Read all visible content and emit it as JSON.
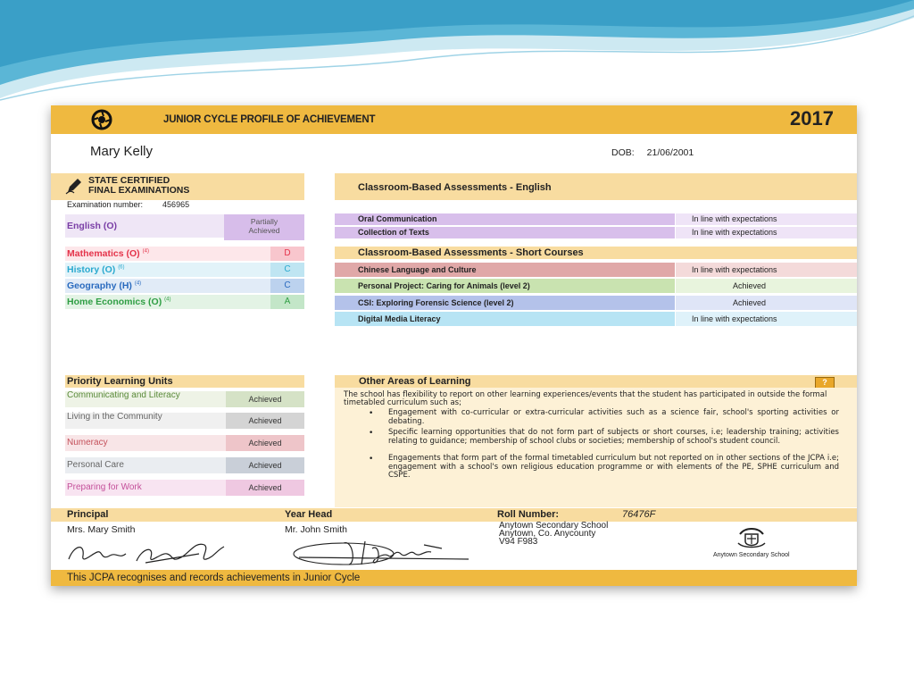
{
  "header": {
    "title": "JUNIOR CYCLE PROFILE OF ACHIEVEMENT",
    "year": "2017"
  },
  "student": {
    "name": "Mary Kelly",
    "dob_label": "DOB:",
    "dob": "21/06/2001"
  },
  "state_exams": {
    "heading_line1": "STATE CERTIFIED",
    "heading_line2": "FINAL EXAMINATIONS",
    "exam_number_label": "Examination number:",
    "exam_number": "456965",
    "subjects": [
      {
        "name": "English (O)",
        "note": "",
        "grade": "Partially Achieved",
        "color": "#7a3fa6"
      },
      {
        "name": "Mathematics (O)",
        "note": "(4)",
        "grade": "D",
        "color": "#e4334a"
      },
      {
        "name": "History (O)",
        "note": "(6)",
        "grade": "C",
        "color": "#2aa9cf"
      },
      {
        "name": "Geography (H)",
        "note": "(4)",
        "grade": "C",
        "color": "#2a6bbf"
      },
      {
        "name": "Home Economics (O)",
        "note": "(4)",
        "grade": "A",
        "color": "#2f9e44"
      }
    ],
    "english_grade_line1": "Partially",
    "english_grade_line2": "Achieved"
  },
  "cba_english": {
    "heading": "Classroom-Based Assessments - English",
    "rows": [
      {
        "name": "Oral Communication",
        "result": "In line with expectations"
      },
      {
        "name": "Collection of Texts",
        "result": "In line with expectations"
      }
    ]
  },
  "cba_short": {
    "heading": "Classroom-Based Assessments - Short Courses",
    "rows": [
      {
        "name": "Chinese Language and Culture",
        "result": "In line with expectations"
      },
      {
        "name": "Personal Project: Caring for Animals (level 2)",
        "result": "Achieved"
      },
      {
        "name": "CSI: Exploring Forensic Science (level 2)",
        "result": "Achieved"
      },
      {
        "name": "Digital Media Literacy",
        "result": "In line with expectations"
      }
    ]
  },
  "plu": {
    "heading": "Priority Learning Units",
    "rows": [
      {
        "name": "Communicating and Literacy",
        "result": "Achieved"
      },
      {
        "name": "Living in the Community",
        "result": "Achieved"
      },
      {
        "name": "Numeracy",
        "result": "Achieved"
      },
      {
        "name": "Personal Care",
        "result": "Achieved"
      },
      {
        "name": "Preparing for Work",
        "result": "Achieved"
      }
    ]
  },
  "other_areas": {
    "heading": "Other Areas of Learning",
    "badge": "?",
    "intro": "The school has flexibility to report on other learning experiences/events that the student has participated in outside the formal timetabled curriculum such as;",
    "bullets": [
      "Engagement with co-curricular or extra-curricular activities such as a science fair, school's sporting activities or debating.",
      "Specific learning opportunities that do not form part of subjects or short courses, i.e; leadership training; activities relating to guidance; membership of school clubs or societies; membership of school's student council.",
      "Engagements that form part of the formal timetabled curriculum but not reported on in other sections of the JCPA i.e; engagement with a school's own religious education programme or with elements of the PE, SPHE curriculum and CSPE."
    ]
  },
  "footer": {
    "principal_label": "Principal",
    "principal_name": "Mrs. Mary Smith",
    "yearhead_label": "Year Head",
    "yearhead_name": "Mr. John Smith",
    "roll_label": "Roll Number:",
    "roll_number": "76476F",
    "school_address_1": "Anytown Secondary School",
    "school_address_2": "Anytown, Co. Anycounty",
    "school_address_3": "V94 F983",
    "school_name": "Anytown Secondary School",
    "statement": "This JCPA recognises and records achievements in Junior Cycle"
  },
  "colors": {
    "accent": "#efb940",
    "light_accent": "#f8dca0"
  }
}
